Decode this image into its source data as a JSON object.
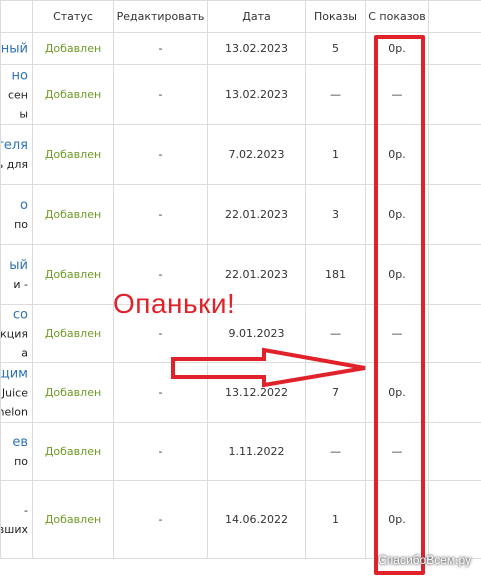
{
  "columns": {
    "status": "Статус",
    "edit": "Редактировать",
    "date": "Дата",
    "views": "Показы",
    "from_views": "С показов"
  },
  "rows": [
    {
      "title_link": "онный",
      "title_sub": "",
      "status": "Добавлен",
      "edit": "-",
      "date": "13.02.2023",
      "views": "5",
      "from_views": "0р."
    },
    {
      "title_link": "но",
      "title_sub": "сен\nы",
      "status": "Добавлен",
      "edit": "-",
      "date": "13.02.2023",
      "views": "—",
      "from_views": "—"
    },
    {
      "title_link": "теля",
      "title_sub": "ль для",
      "status": "Добавлен",
      "edit": "-",
      "date": "7.02.2023",
      "views": "1",
      "from_views": "0р."
    },
    {
      "title_link": "о",
      "title_sub": "по",
      "status": "Добавлен",
      "edit": "-",
      "date": "22.01.2023",
      "views": "3",
      "from_views": "0р."
    },
    {
      "title_link": "ый",
      "title_sub": "и -",
      "status": "Добавлен",
      "edit": "-",
      "date": "22.01.2023",
      "views": "181",
      "from_views": "0р."
    },
    {
      "title_link": "со",
      "title_sub": "укция\nа",
      "status": "Добавлен",
      "edit": "-",
      "date": "9.01.2023",
      "views": "—",
      "from_views": "—"
    },
    {
      "title_link": "ощим",
      "title_sub": "Juice\nnelon",
      "status": "Добавлен",
      "edit": "-",
      "date": "13.12.2022",
      "views": "7",
      "from_views": "0р."
    },
    {
      "title_link": "ев",
      "title_sub": "по",
      "status": "Добавлен",
      "edit": "-",
      "date": "1.11.2022",
      "views": "—",
      "from_views": "—"
    },
    {
      "title_link": "",
      "title_sub": "-\nвших",
      "status": "Добавлен",
      "edit": "-",
      "date": "14.06.2022",
      "views": "1",
      "from_views": "0р."
    }
  ],
  "annotation": {
    "caption": "Опаньки!",
    "color": "#e0232b"
  },
  "watermark": "СпасибоВсем.ру"
}
